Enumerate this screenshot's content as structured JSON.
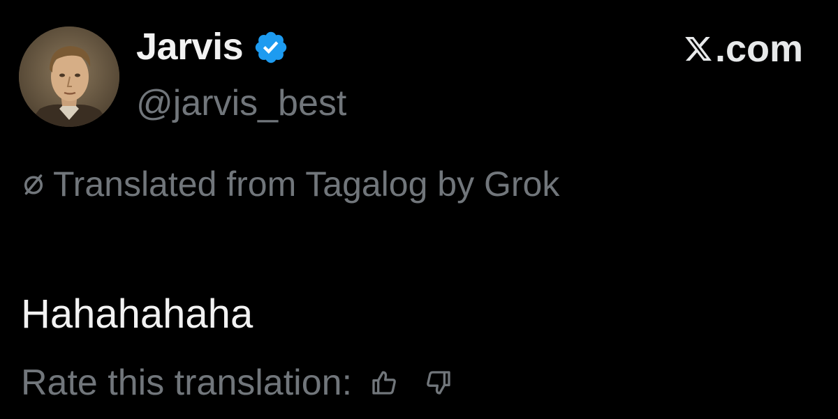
{
  "post": {
    "author": {
      "display_name": "Jarvis",
      "handle": "@jarvis_best",
      "verified": true,
      "avatar_icon": "portrait-avatar"
    },
    "site": {
      "logo_icon": "x-logo-icon",
      "label": ".com"
    },
    "translation_note": {
      "icon": "slashed-circle-icon",
      "text": "Translated from Tagalog by Grok"
    },
    "text": "Hahahahaha",
    "rating": {
      "label": "Rate this translation:",
      "thumbs_up_icon": "thumbs-up-icon",
      "thumbs_down_icon": "thumbs-down-icon"
    }
  },
  "colors": {
    "background": "#000000",
    "primary_text": "#f2f2f2",
    "secondary_text": "#71767b",
    "verified_badge": "#1d9bf0"
  }
}
